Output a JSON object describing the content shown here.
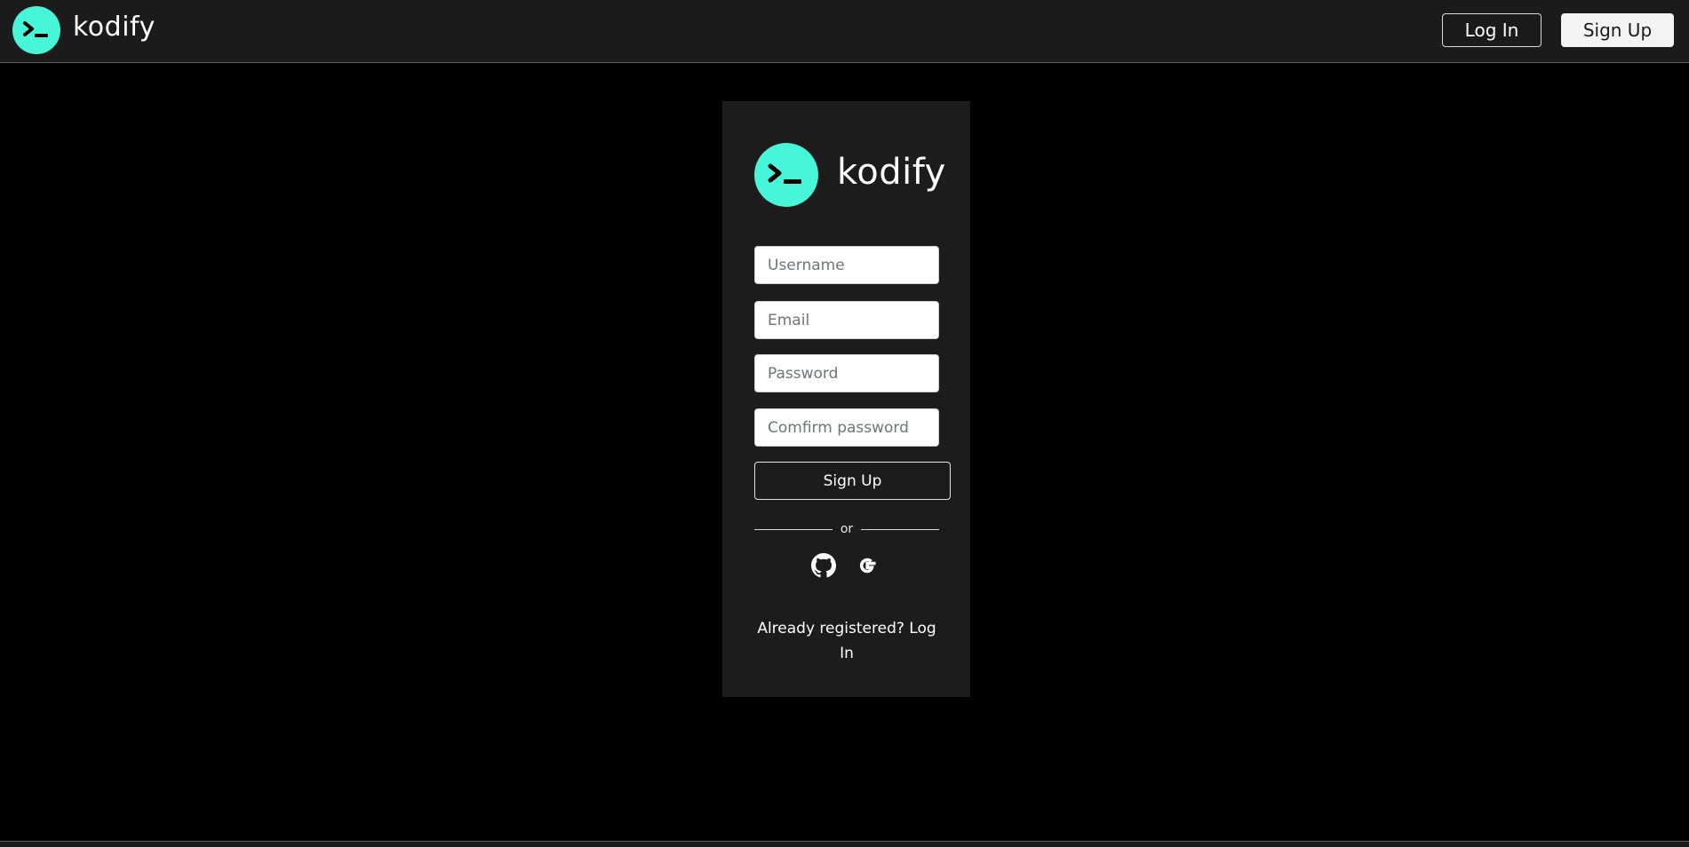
{
  "nav": {
    "brand": "kodify",
    "login_label": "Log In",
    "signup_label": "Sign Up"
  },
  "card": {
    "brand": "kodify",
    "fields": {
      "username_placeholder": "Username",
      "email_placeholder": "Email",
      "password_placeholder": "Password",
      "confirm_placeholder": "Comfirm password"
    },
    "submit_label": "Sign Up",
    "divider_text": "or",
    "social": [
      "github-icon",
      "google-icon"
    ],
    "already_text": "Already registered?",
    "login_link": "Log In"
  },
  "colors": {
    "accent": "#47f5d8",
    "nav_bg": "#1b1b1b",
    "card_bg": "#1c1c1c",
    "page_bg": "#000000"
  }
}
